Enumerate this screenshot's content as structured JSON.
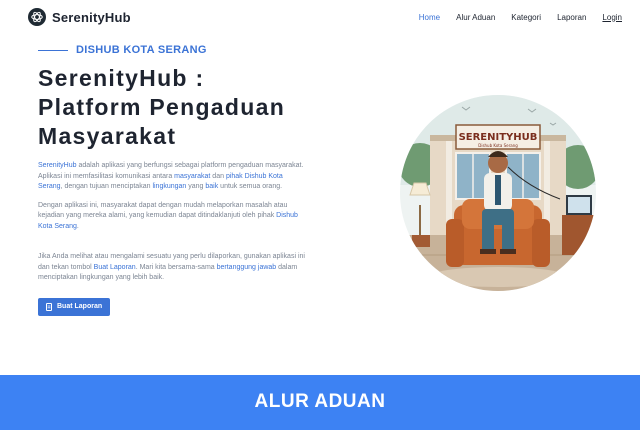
{
  "brand": {
    "name": "SerenityHub",
    "logo_icon": "openai-knot-icon"
  },
  "nav": {
    "items": [
      {
        "label": "Home",
        "active": true
      },
      {
        "label": "Alur Aduan",
        "active": false
      },
      {
        "label": "Kategori",
        "active": false
      },
      {
        "label": "Laporan",
        "active": false
      },
      {
        "label": "Login",
        "active": false
      }
    ]
  },
  "hero": {
    "eyebrow": "DISHUB KOTA SERANG",
    "title_lines": [
      "SerenityHub :",
      "Platform Pengaduan",
      "Masyarakat"
    ],
    "p1": {
      "s1": "SerenityHub",
      "s2": " adalah aplikasi yang berfungsi sebagai platform pengaduan masyarakat. Aplikasi ini memfasilitasi komunikasi antara ",
      "s3": "masyarakat",
      "s4": " dan ",
      "s5": "pihak Dishub Kota Serang",
      "s6": ", dengan tujuan menciptakan ",
      "s7": "lingkungan",
      "s8": " yang ",
      "s9": "baik",
      "s10": " untuk semua orang."
    },
    "p2": {
      "s1": "Dengan aplikasi ini, masyarakat dapat dengan mudah melaporkan masalah atau kejadian yang mereka alami, yang kemudian dapat ditindaklanjuti oleh pihak ",
      "s2": "Dishub Kota Serang",
      "s3": "."
    },
    "p3": {
      "s1": "Jika Anda melihat atau mengalami sesuatu yang perlu dilaporkan, gunakan aplikasi ini dan tekan tombol ",
      "s2": "Buat Laporan",
      "s3": ". Mari kita bersama-sama ",
      "s4": "bertanggung jawab",
      "s5": " dalam menciptakan lingkungan yang lebih baik."
    },
    "cta": {
      "label": "Buat Laporan",
      "icon": "document-icon"
    },
    "illustration": {
      "sign_title": "SERENITYHUB",
      "sign_subtitle": "Dishub Kota Serang"
    }
  },
  "section": {
    "title": "ALUR ADUAN"
  },
  "colors": {
    "accent": "#3b73d6",
    "band": "#3d82f3",
    "text": "#1e2430",
    "muted": "#7c8593"
  }
}
